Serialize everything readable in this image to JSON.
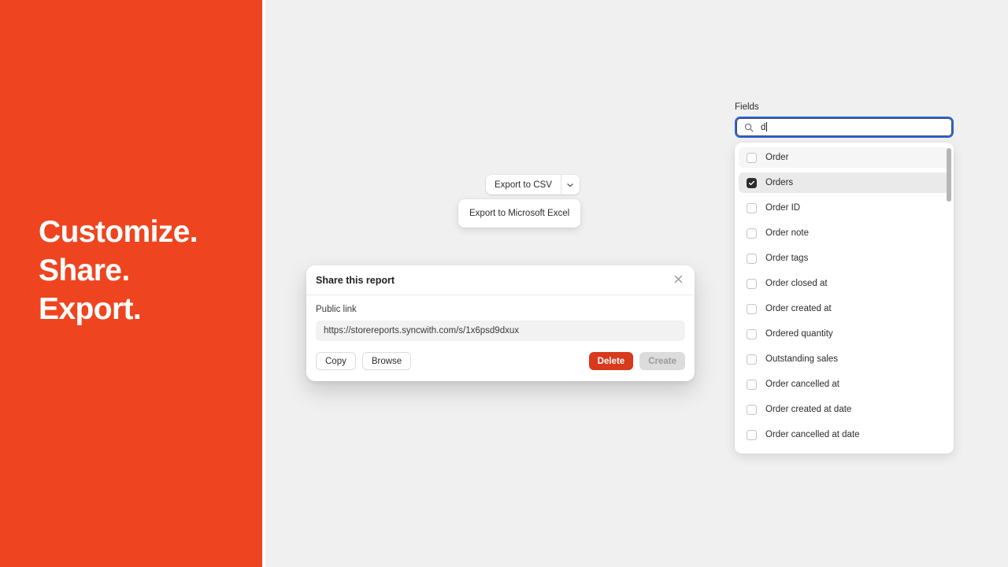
{
  "hero": {
    "lines": [
      "Customize.",
      "Share.",
      "Export."
    ],
    "background_color": "#ee4520"
  },
  "export": {
    "button_label": "Export to CSV",
    "caret_icon": "chevron-down-icon",
    "menu_items": [
      "Export to Microsoft Excel"
    ]
  },
  "share_dialog": {
    "title": "Share this report",
    "close_icon": "close-icon",
    "public_link_label": "Public link",
    "public_link_value": "https://storereports.syncwith.com/s/1x6psd9dxux",
    "copy_label": "Copy",
    "browse_label": "Browse",
    "delete_label": "Delete",
    "create_label": "Create",
    "delete_color": "#d73a1d",
    "create_disabled": true
  },
  "fields": {
    "label": "Fields",
    "search_icon": "search-icon",
    "search_value": "d",
    "focus_ring_color": "#2a64e0",
    "items": [
      {
        "label": "Order",
        "checked": false,
        "row_style": "shade-light"
      },
      {
        "label": "Orders",
        "checked": true,
        "row_style": "shade-dark"
      },
      {
        "label": "Order ID",
        "checked": false,
        "row_style": ""
      },
      {
        "label": "Order note",
        "checked": false,
        "row_style": ""
      },
      {
        "label": "Order tags",
        "checked": false,
        "row_style": ""
      },
      {
        "label": "Order closed at",
        "checked": false,
        "row_style": ""
      },
      {
        "label": "Order created at",
        "checked": false,
        "row_style": ""
      },
      {
        "label": "Ordered quantity",
        "checked": false,
        "row_style": ""
      },
      {
        "label": "Outstanding sales",
        "checked": false,
        "row_style": ""
      },
      {
        "label": "Order cancelled at",
        "checked": false,
        "row_style": ""
      },
      {
        "label": "Order created at date",
        "checked": false,
        "row_style": ""
      },
      {
        "label": "Order cancelled at date",
        "checked": false,
        "row_style": ""
      },
      {
        "label": "",
        "checked": false,
        "row_style": ""
      }
    ],
    "scrollbar_thumb_color": "#b6b6b8"
  }
}
